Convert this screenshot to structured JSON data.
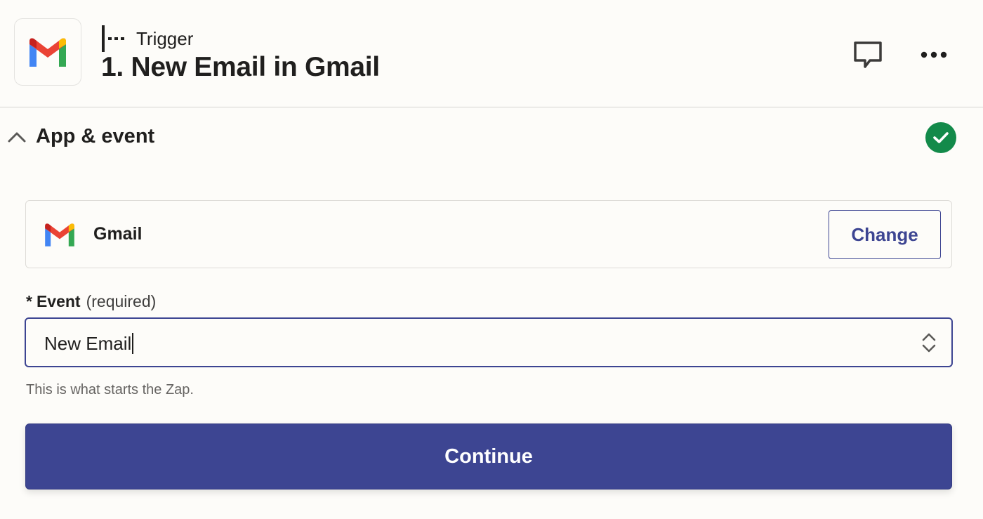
{
  "step": {
    "type_label": "Trigger",
    "title": "1. New Email in Gmail",
    "app_icon": "gmail-logo"
  },
  "header_actions": {
    "comment_icon": "comment-icon",
    "more_icon": "more-horizontal-icon"
  },
  "section": {
    "title": "App & event",
    "expanded": true,
    "status": "complete",
    "status_color": "#138a4a"
  },
  "app_card": {
    "app_name": "Gmail",
    "change_label": "Change"
  },
  "event_field": {
    "asterisk": "*",
    "label": "Event",
    "required_text": "(required)",
    "value": "New Email",
    "helper": "This is what starts the Zap."
  },
  "continue_label": "Continue",
  "colors": {
    "primary": "#3d4592",
    "background": "#fdfcf9",
    "success": "#138a4a"
  }
}
